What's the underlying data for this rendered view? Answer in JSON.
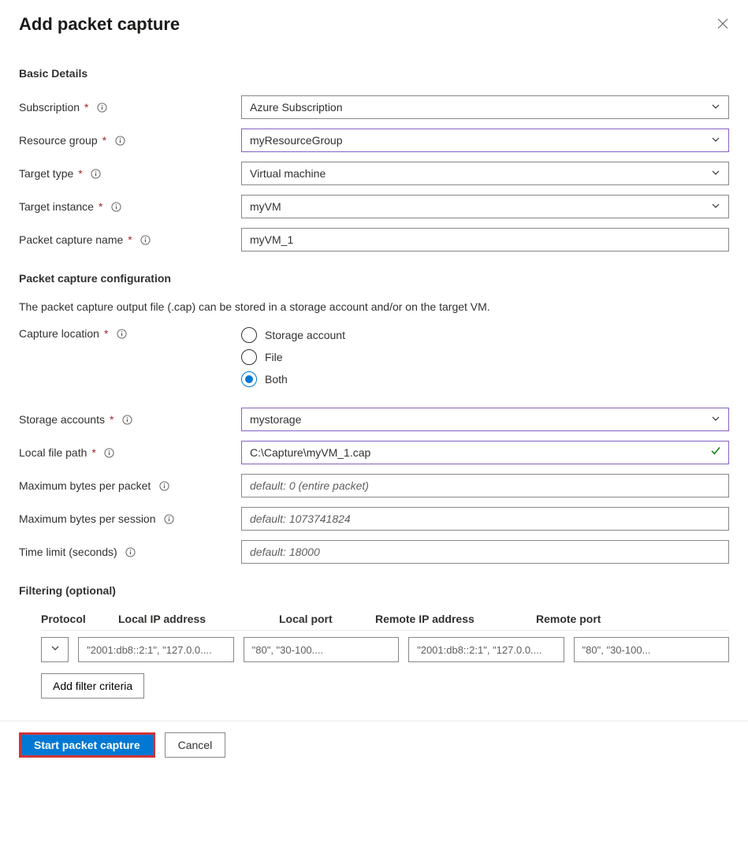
{
  "title": "Add packet capture",
  "sections": {
    "basic": "Basic Details",
    "config": "Packet capture configuration",
    "filtering": "Filtering (optional)"
  },
  "labels": {
    "subscription": "Subscription",
    "resourceGroup": "Resource group",
    "targetType": "Target type",
    "targetInstance": "Target instance",
    "captureName": "Packet capture name",
    "captureLocation": "Capture location",
    "storageAccounts": "Storage accounts",
    "localFilePath": "Local file path",
    "maxBytesPacket": "Maximum bytes per packet",
    "maxBytesSession": "Maximum bytes per session",
    "timeLimit": "Time limit (seconds)"
  },
  "values": {
    "subscription": "Azure Subscription",
    "resourceGroup": "myResourceGroup",
    "targetType": "Virtual machine",
    "targetInstance": "myVM",
    "captureName": "myVM_1",
    "storageAccounts": "mystorage",
    "localFilePath": "C:\\Capture\\myVM_1.cap"
  },
  "placeholders": {
    "maxBytesPacket": "default: 0 (entire packet)",
    "maxBytesSession": "default: 1073741824",
    "timeLimit": "default: 18000",
    "localIp": "\"2001:db8::2:1\", \"127.0.0....",
    "localPort": "\"80\", \"30-100....",
    "remoteIp": "\"2001:db8::2:1\", \"127.0.0....",
    "remotePort": "\"80\", \"30-100..."
  },
  "configDesc": "The packet capture output file (.cap) can be stored in a storage account and/or on the target VM.",
  "radioOptions": {
    "storage": "Storage account",
    "file": "File",
    "both": "Both"
  },
  "filterHeaders": {
    "protocol": "Protocol",
    "localIp": "Local IP address",
    "localPort": "Local port",
    "remoteIp": "Remote IP address",
    "remotePort": "Remote port"
  },
  "buttons": {
    "addFilter": "Add filter criteria",
    "start": "Start packet capture",
    "cancel": "Cancel"
  }
}
